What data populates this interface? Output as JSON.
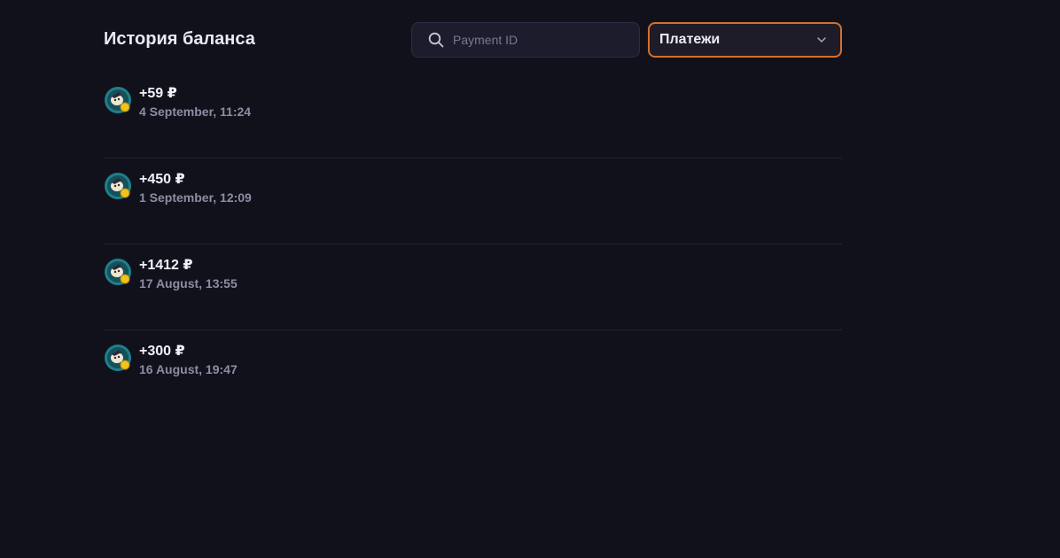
{
  "header": {
    "title": "История баланса"
  },
  "search": {
    "placeholder": "Payment ID",
    "value": "",
    "icon": "search-icon"
  },
  "filter": {
    "selected": "Платежи",
    "icon": "chevron-down-icon",
    "accent_color": "#d86f28"
  },
  "transactions": [
    {
      "amount": "+59 ₽",
      "date": "4 September, 11:24",
      "icon": "payment-avatar-icon"
    },
    {
      "amount": "+450 ₽",
      "date": "1 September, 12:09",
      "icon": "payment-avatar-icon"
    },
    {
      "amount": "+1412 ₽",
      "date": "17 August, 13:55",
      "icon": "payment-avatar-icon"
    },
    {
      "amount": "+300 ₽",
      "date": "16 August, 19:47",
      "icon": "payment-avatar-icon"
    }
  ],
  "colors": {
    "background": "#11111c",
    "secondary_text": "#8e8ca3",
    "avatar_ring": "#1f7f8a",
    "coin": "#f0c419"
  }
}
